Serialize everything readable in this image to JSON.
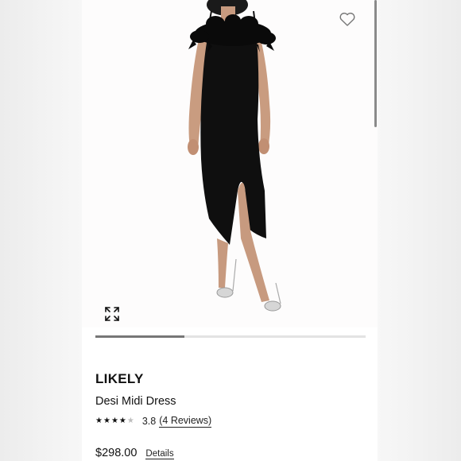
{
  "product": {
    "brand": "LIKELY",
    "name": "Desi Midi Dress",
    "rating": {
      "stars_filled": 4,
      "stars_total": 5,
      "value": "3.8",
      "reviews_label": "(4 Reviews)"
    },
    "price": "$298.00",
    "details_label": "Details"
  },
  "gallery": {
    "progress_fraction": 0.33,
    "image_description_icon": "dress-model-photo"
  },
  "icons": {
    "favorite": "heart-outline-icon",
    "expand": "expand-arrows-icon"
  },
  "colors": {
    "text": "#111111",
    "progress": "#777777",
    "track": "#e3e3e3",
    "star_off": "#bdbdbd"
  }
}
